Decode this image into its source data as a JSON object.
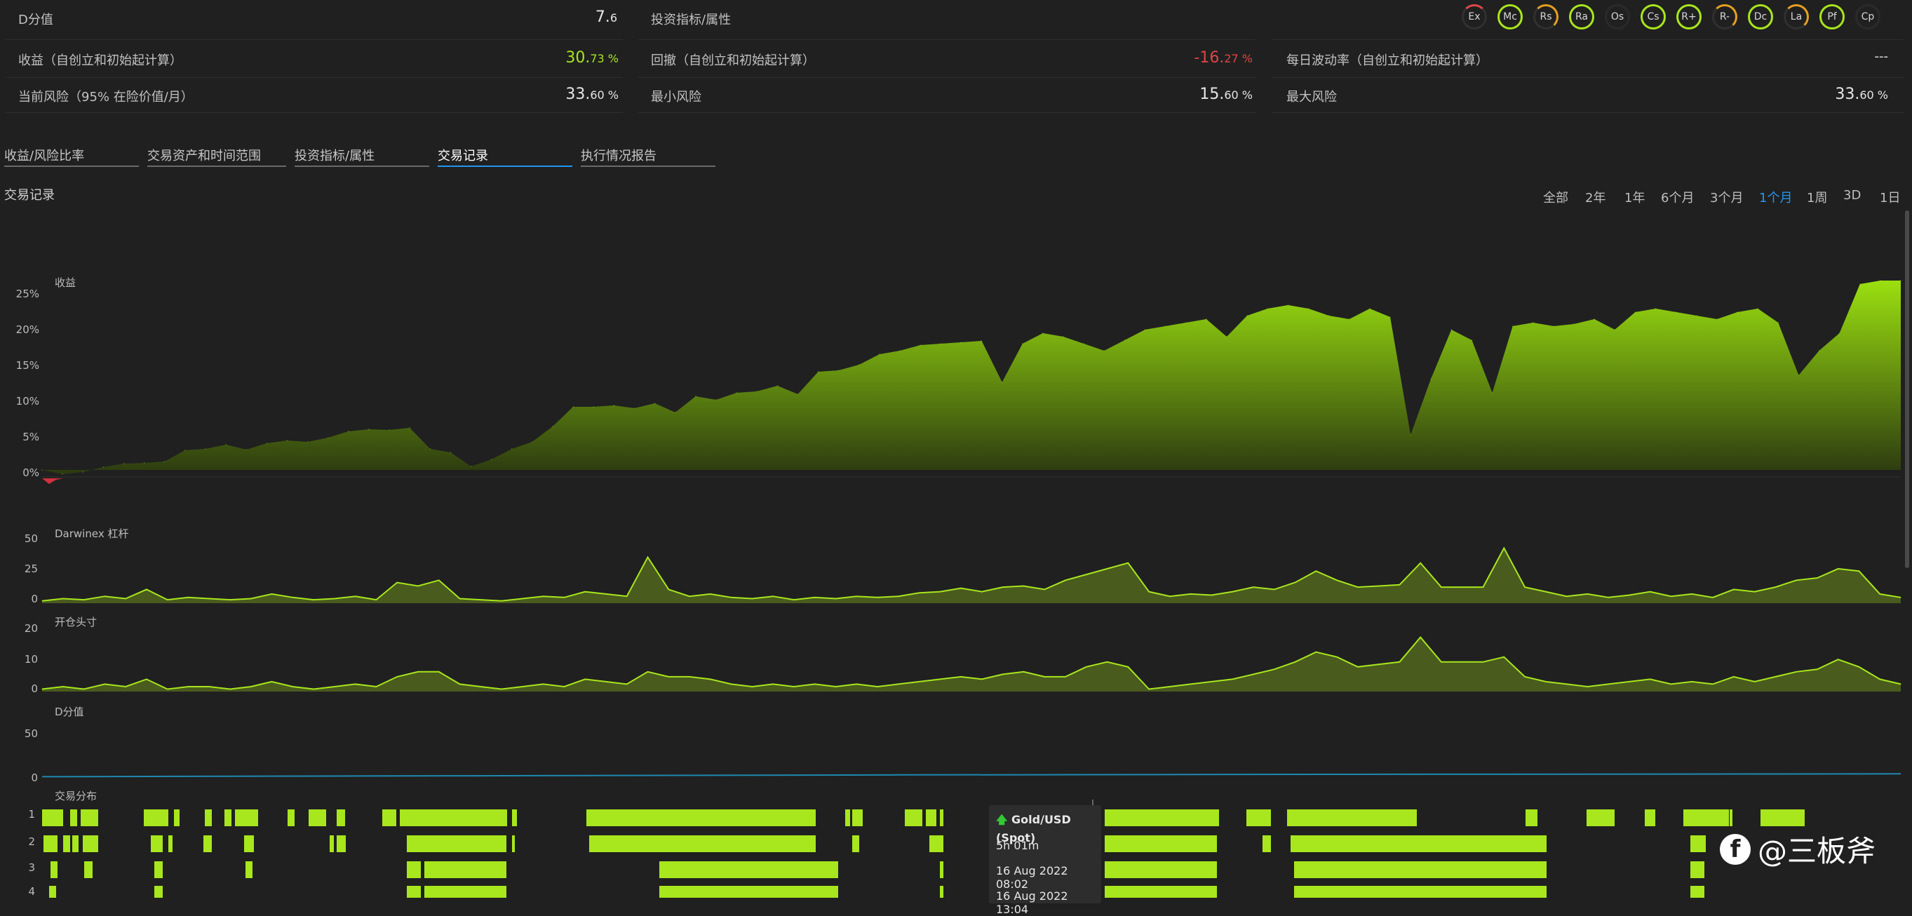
{
  "metrics": {
    "dscore_label": "D分值",
    "dscore_value": "7.",
    "dscore_decimal": "6",
    "attributes_label": "投资指标/属性",
    "return_label": "收益（自创立和初始起计算）",
    "return_value": "30.",
    "return_decimal": "73 %",
    "drawdown_label": "回撤（自创立和初始起计算）",
    "drawdown_value": "-16.",
    "drawdown_decimal": "27 %",
    "volatility_label": "每日波动率（自创立和初始起计算）",
    "volatility_value": "---",
    "risk_label": "当前风险（95% 在险价值/月）",
    "risk_value": "33.",
    "risk_decimal": "60 %",
    "minrisk_label": "最小风险",
    "minrisk_value": "15.",
    "minrisk_decimal": "60 %",
    "maxrisk_label": "最大风险",
    "maxrisk_value": "33.",
    "maxrisk_decimal": "60 %"
  },
  "attribute_badges": [
    "Ex",
    "Mc",
    "Rs",
    "Ra",
    "Os",
    "Cs",
    "R+",
    "R-",
    "Dc",
    "La",
    "Pf",
    "Cp"
  ],
  "tabs": [
    "收益/风险比率",
    "交易资产和时间范围",
    "投资指标/属性",
    "交易记录",
    "执行情况报告"
  ],
  "active_tab": 3,
  "section_title": "交易记录",
  "time_ranges": [
    "全部",
    "2年",
    "1年",
    "6个月",
    "3个月",
    "1个月",
    "1周",
    "3D",
    "1日"
  ],
  "active_range": 5,
  "colors": {
    "accent": "#a8e61d",
    "blue": "#2196f3",
    "negative": "#e04444",
    "background": "#202020"
  },
  "chart_data": [
    {
      "type": "area",
      "title": "收益",
      "yticks": [
        "25%",
        "20%",
        "15%",
        "10%",
        "5%",
        "0%"
      ],
      "ylim": [
        -1,
        27
      ],
      "values": [
        0,
        -0.6,
        -0.3,
        0.4,
        0.9,
        1.0,
        1.2,
        2.8,
        3.0,
        3.6,
        2.9,
        3.8,
        4.2,
        4.0,
        4.6,
        5.5,
        5.8,
        5.7,
        6.0,
        3.0,
        2.5,
        0.5,
        1.5,
        3.0,
        4.0,
        6.2,
        9.0,
        9.0,
        9.2,
        8.8,
        9.5,
        8.2,
        10.5,
        10.0,
        11.0,
        11.2,
        12.0,
        10.8,
        14.0,
        14.2,
        15.0,
        16.5,
        17.0,
        17.8,
        18.0,
        18.2,
        18.4,
        12.5,
        18.0,
        19.5,
        19.0,
        18.0,
        17.0,
        18.5,
        20.0,
        20.5,
        21.0,
        21.5,
        19.0,
        22.0,
        23.0,
        23.5,
        23.0,
        22.0,
        21.5,
        23.0,
        21.8,
        5.0,
        13.0,
        20.0,
        18.5,
        11.0,
        20.5,
        21.0,
        20.5,
        20.8,
        21.5,
        20.0,
        22.5,
        23.0,
        22.5,
        22.0,
        21.5,
        22.5,
        23.0,
        21.0,
        13.5,
        17.0,
        19.5,
        26.5,
        27.0,
        27.0
      ]
    },
    {
      "type": "area",
      "title": "Darwinex 杠杆",
      "yticks": [
        "50",
        "25",
        "0"
      ],
      "ylim": [
        0,
        55
      ],
      "values": [
        2,
        4,
        3,
        6,
        4,
        12,
        3,
        5,
        4,
        3,
        4,
        8,
        5,
        3,
        4,
        6,
        3,
        18,
        15,
        20,
        4,
        3,
        2,
        4,
        6,
        5,
        10,
        8,
        6,
        40,
        12,
        6,
        8,
        5,
        4,
        6,
        3,
        5,
        4,
        6,
        5,
        6,
        9,
        10,
        13,
        10,
        14,
        15,
        12,
        20,
        25,
        30,
        35,
        10,
        6,
        8,
        7,
        10,
        14,
        12,
        18,
        28,
        20,
        14,
        15,
        16,
        35,
        14,
        14,
        14,
        48,
        14,
        10,
        6,
        8,
        5,
        7,
        10,
        6,
        8,
        5,
        12,
        10,
        14,
        20,
        22,
        30,
        28,
        8,
        5
      ]
    },
    {
      "type": "area",
      "title": "开仓头寸",
      "yticks": [
        "20",
        "10",
        "0"
      ],
      "ylim": [
        0,
        25
      ],
      "values": [
        1,
        2,
        1,
        3,
        2,
        5,
        1,
        2,
        2,
        1,
        2,
        4,
        2,
        1,
        2,
        3,
        2,
        6,
        8,
        8,
        3,
        2,
        1,
        2,
        3,
        2,
        5,
        4,
        3,
        8,
        6,
        6,
        5,
        3,
        2,
        3,
        2,
        3,
        2,
        3,
        2,
        3,
        4,
        5,
        6,
        5,
        7,
        8,
        6,
        6,
        10,
        12,
        10,
        1,
        2,
        3,
        4,
        5,
        7,
        9,
        12,
        16,
        14,
        10,
        11,
        12,
        22,
        12,
        12,
        12,
        14,
        6,
        4,
        3,
        2,
        3,
        4,
        5,
        3,
        4,
        3,
        6,
        4,
        6,
        8,
        9,
        13,
        10,
        5,
        3
      ]
    },
    {
      "type": "line",
      "title": "D分值",
      "yticks": [
        "50",
        "0"
      ],
      "ylim": [
        0,
        80
      ],
      "values": [
        3,
        3.5,
        4,
        4.5,
        5,
        5.5,
        6,
        6.2,
        6.5,
        6.8,
        7,
        7.2,
        7.4,
        7.6
      ]
    },
    {
      "type": "bar",
      "title": "交易分布",
      "yticks": [
        "1",
        "2",
        "3",
        "4"
      ]
    }
  ],
  "tooltip": {
    "asset": "Gold/USD (Spot)",
    "duration": "5h 01m",
    "opened": "16 Aug 2022 08:02",
    "closed": "16 Aug 2022 13:04"
  },
  "watermark": {
    "platform": "f",
    "text": "@三板斧"
  }
}
